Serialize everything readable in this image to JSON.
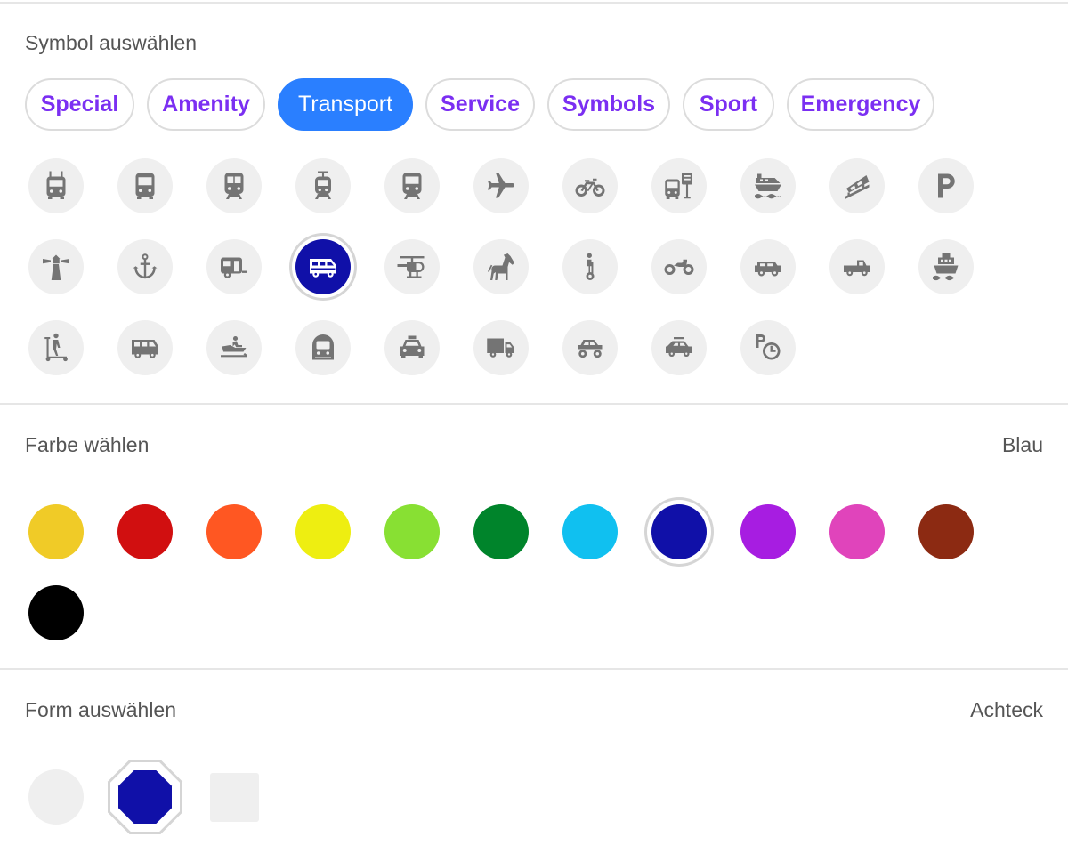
{
  "symbol_section": {
    "title": "Symbol auswählen",
    "categories": [
      {
        "label": "Special",
        "active": false
      },
      {
        "label": "Amenity",
        "active": false
      },
      {
        "label": "Transport",
        "active": true
      },
      {
        "label": "Service",
        "active": false
      },
      {
        "label": "Symbols",
        "active": false
      },
      {
        "label": "Sport",
        "active": false
      },
      {
        "label": "Emergency",
        "active": false
      }
    ],
    "icons": [
      "trolleybus-icon",
      "bus-icon",
      "train-icon",
      "tram-icon",
      "subway-icon",
      "airplane-icon",
      "bicycle-icon",
      "bus-stop-icon",
      "car-ferry-icon",
      "funicular-icon",
      "parking-icon",
      "lighthouse-icon",
      "anchor-icon",
      "caravan-icon",
      "camper-van-icon",
      "helicopter-icon",
      "horse-icon",
      "segway-icon",
      "motorcycle-icon",
      "jeep-icon",
      "pickup-truck-icon",
      "ship-icon",
      "scooter-icon",
      "minibus-icon",
      "snowmobile-icon",
      "metro-icon",
      "taxi-icon",
      "truck-icon",
      "atv-icon",
      "car-sharing-icon",
      "parking-time-icon"
    ],
    "selected_icon": "camper-van-icon"
  },
  "color_section": {
    "title": "Farbe wählen",
    "selected_label": "Blau",
    "colors": [
      "#f0cb27",
      "#d10f10",
      "#ff5722",
      "#eeee11",
      "#88e033",
      "#00842b",
      "#10c0f0",
      "#1010a8",
      "#a71de1",
      "#e044bb",
      "#8c2a12",
      "#000000"
    ],
    "selected_color": "#1010a8"
  },
  "shape_section": {
    "title": "Form auswählen",
    "selected_label": "Achteck",
    "shapes": [
      "circle-shape",
      "octagon-shape",
      "square-shape"
    ],
    "selected_shape": "octagon-shape"
  }
}
